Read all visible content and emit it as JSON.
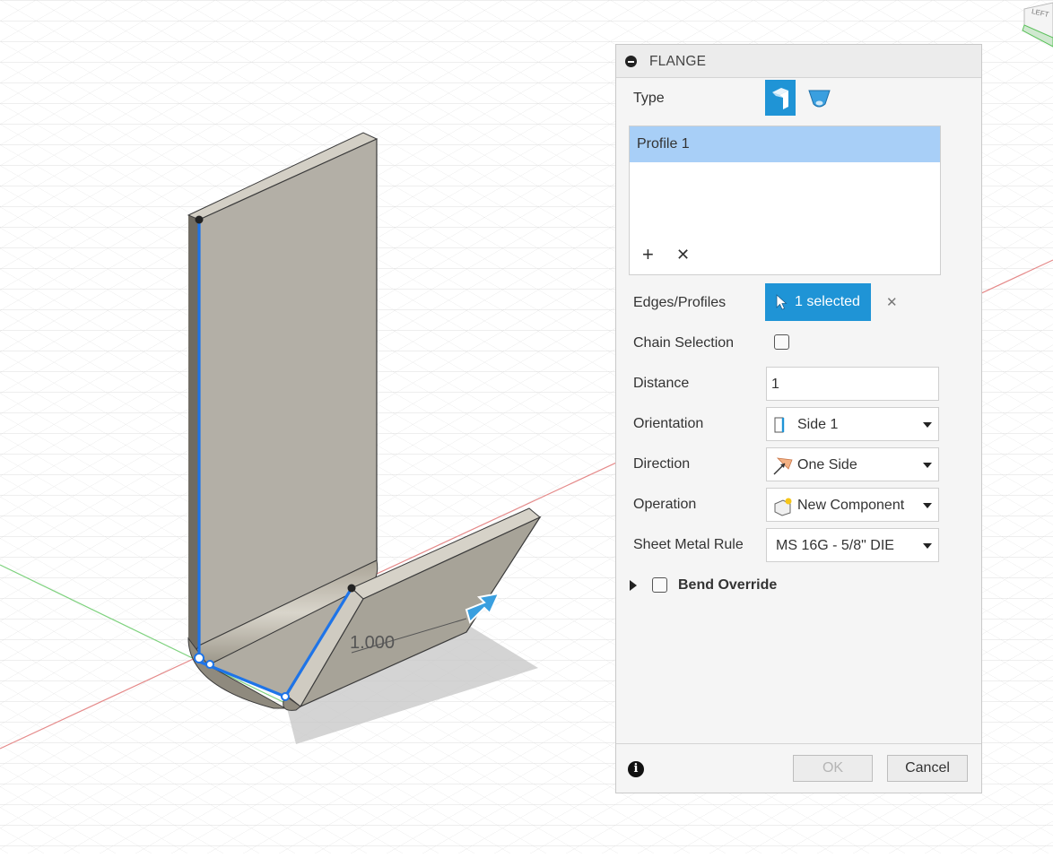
{
  "viewport": {
    "dimension_value": "1.000",
    "viewcube_face": "LEFT"
  },
  "panel": {
    "title": "FLANGE",
    "type_label": "Type",
    "profile_list": {
      "items": [
        "Profile 1"
      ],
      "add_glyph": "+",
      "remove_glyph": "✕"
    },
    "edges_label": "Edges/Profiles",
    "edges_value": "1 selected",
    "edges_clear_glyph": "✕",
    "chain_label": "Chain Selection",
    "chain_checked": false,
    "distance_label": "Distance",
    "distance_value": "1",
    "orientation_label": "Orientation",
    "orientation_value": "Side 1",
    "direction_label": "Direction",
    "direction_value": "One Side",
    "operation_label": "Operation",
    "operation_value": "New Component",
    "rule_label": "Sheet Metal Rule",
    "rule_value": "MS 16G - 5/8\" DIE",
    "bend_override_label": "Bend Override",
    "bend_override_checked": false,
    "info_glyph": "i",
    "ok_label": "OK",
    "cancel_label": "Cancel"
  },
  "colors": {
    "accent": "#1f94d6",
    "selection": "#a8cff7",
    "edge_highlight": "#1e74e8"
  }
}
